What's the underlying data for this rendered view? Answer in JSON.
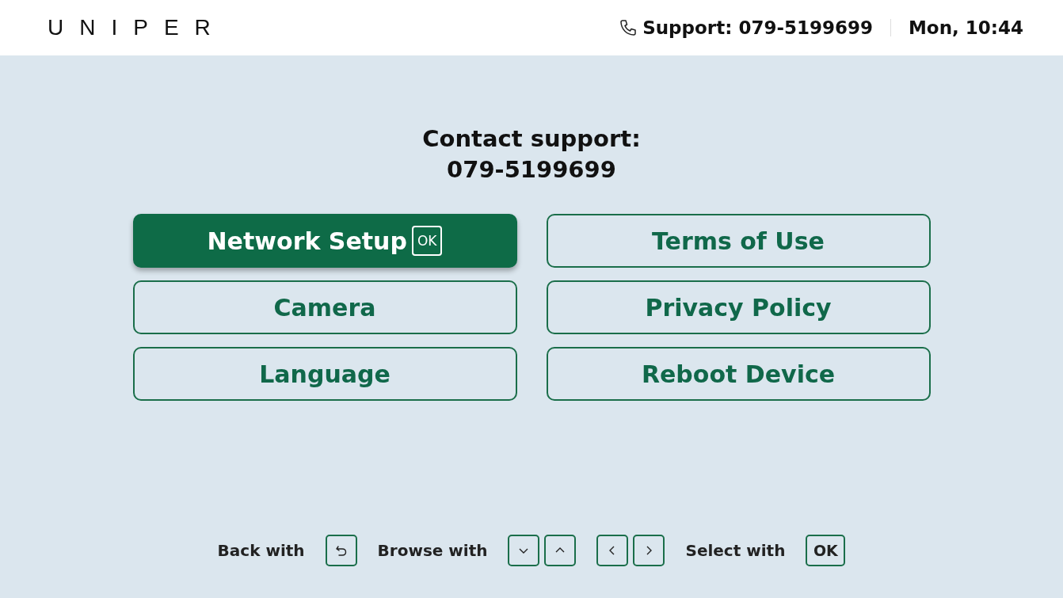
{
  "header": {
    "logo": "UNIPER",
    "support": "Support: 079-5199699",
    "datetime": "Mon, 10:44"
  },
  "contact": {
    "title": "Contact support:",
    "phone": "079-5199699"
  },
  "menu": {
    "ok_hint": "OK",
    "items": [
      {
        "label": "Network Setup",
        "selected": true
      },
      {
        "label": "Terms of Use",
        "selected": false
      },
      {
        "label": "Camera",
        "selected": false
      },
      {
        "label": "Privacy Policy",
        "selected": false
      },
      {
        "label": "Language",
        "selected": false
      },
      {
        "label": "Reboot Device",
        "selected": false
      }
    ]
  },
  "footer": {
    "back_label": "Back with",
    "browse_label": "Browse with",
    "select_label": "Select with",
    "select_key": "OK"
  }
}
